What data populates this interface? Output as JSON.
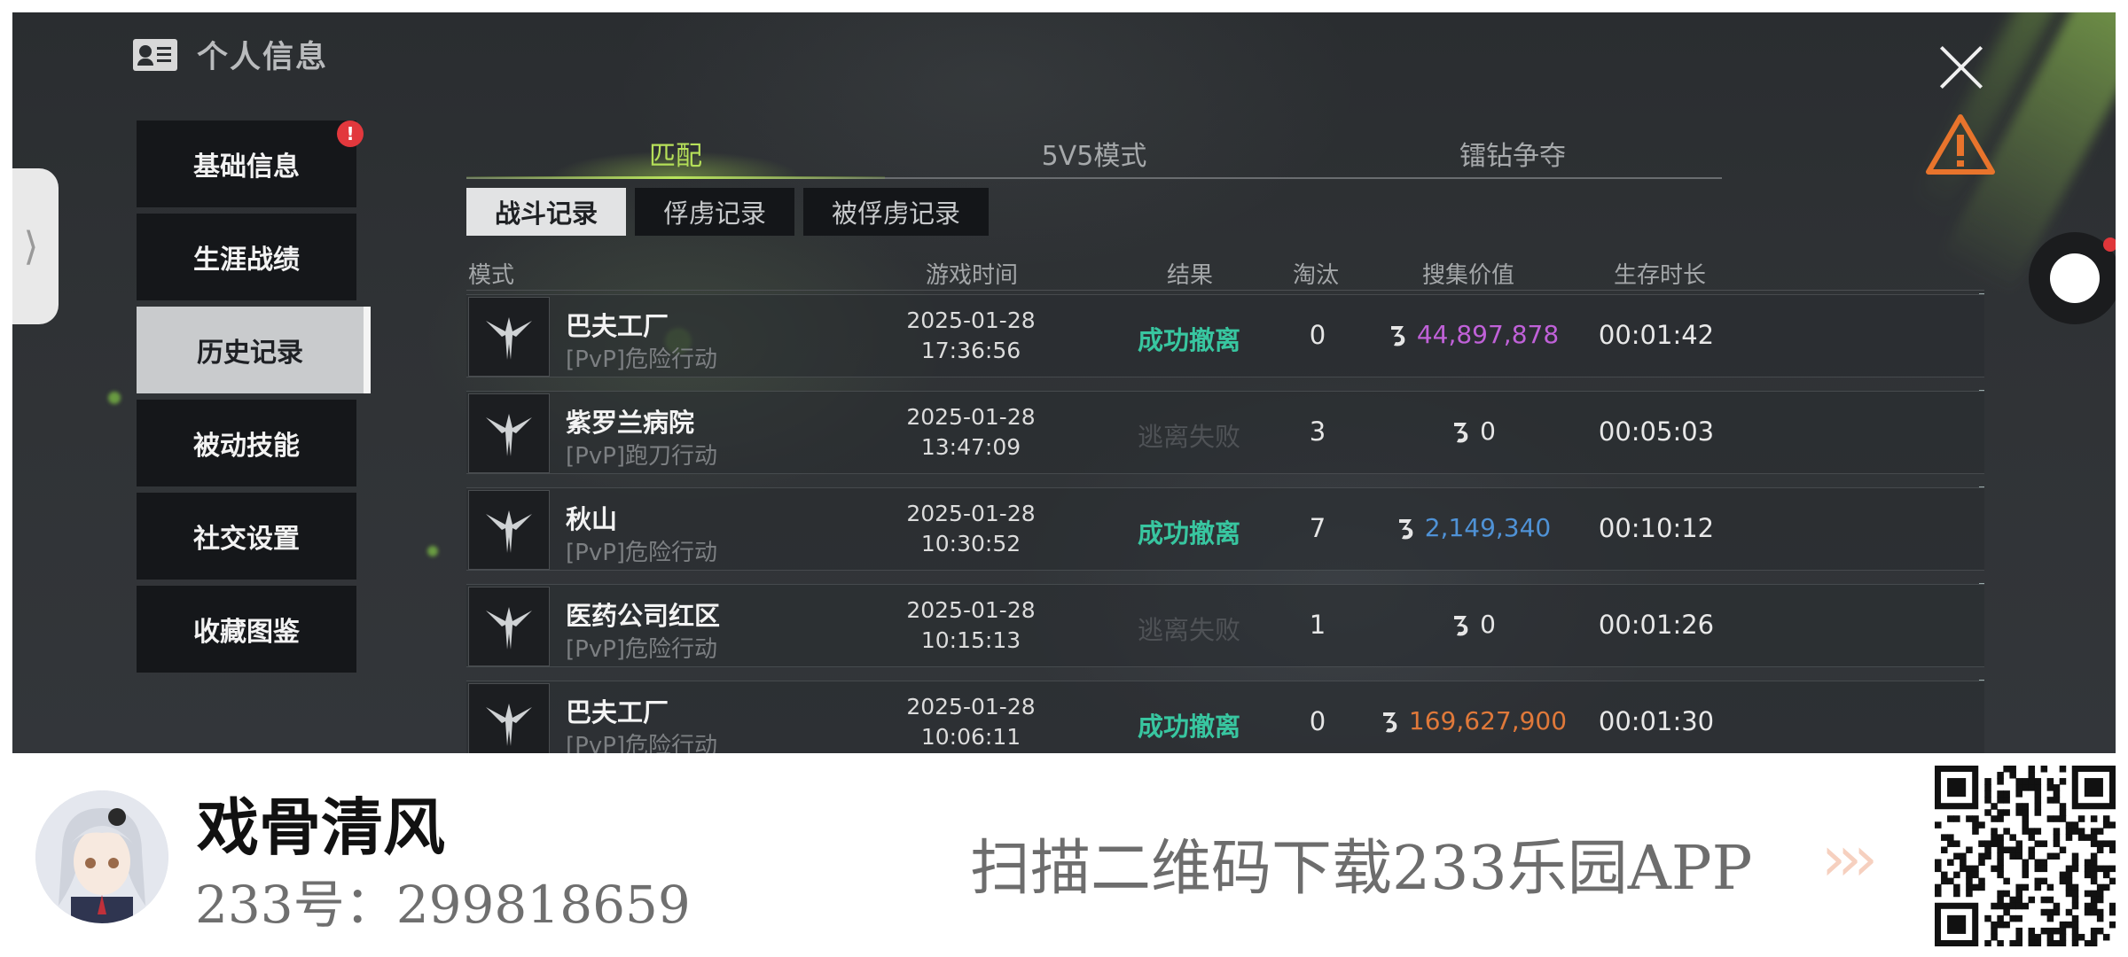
{
  "header": {
    "title": "个人信息"
  },
  "menu": {
    "items": [
      {
        "label": "基础信息",
        "badge": "!"
      },
      {
        "label": "生涯战绩"
      },
      {
        "label": "历史记录",
        "active": true
      },
      {
        "label": "被动技能"
      },
      {
        "label": "社交设置"
      },
      {
        "label": "收藏图鉴"
      }
    ]
  },
  "main_tabs": [
    {
      "label": "匹配",
      "active": true
    },
    {
      "label": "5V5模式"
    },
    {
      "label": "镭钻争夺"
    }
  ],
  "sub_tabs": [
    {
      "label": "战斗记录",
      "active": true
    },
    {
      "label": "俘虏记录"
    },
    {
      "label": "被俘虏记录"
    }
  ],
  "table": {
    "headers": {
      "mode": "模式",
      "game_time": "游戏时间",
      "result": "结果",
      "kills": "淘汰",
      "value": "搜集价值",
      "survival": "生存时长"
    },
    "rows": [
      {
        "map": "巴夫工厂",
        "mode": "[PvP]危险行动",
        "date": "2025-01-28",
        "time": "17:36:56",
        "result": "成功撤离",
        "kills": "0",
        "value": "44,897,878",
        "survival": "00:01:42"
      },
      {
        "map": "紫罗兰病院",
        "mode": "[PvP]跑刀行动",
        "date": "2025-01-28",
        "time": "13:47:09",
        "result": "逃离失败",
        "kills": "3",
        "value": "0",
        "survival": "00:05:03"
      },
      {
        "map": "秋山",
        "mode": "[PvP]危险行动",
        "date": "2025-01-28",
        "time": "10:30:52",
        "result": "成功撤离",
        "kills": "7",
        "value": "2,149,340",
        "survival": "00:10:12"
      },
      {
        "map": "医药公司红区",
        "mode": "[PvP]危险行动",
        "date": "2025-01-28",
        "time": "10:15:13",
        "result": "逃离失败",
        "kills": "1",
        "value": "0",
        "survival": "00:01:26"
      },
      {
        "map": "巴夫工厂",
        "mode": "[PvP]危险行动",
        "date": "2025-01-28",
        "time": "10:06:11",
        "result": "成功撤离",
        "kills": "0",
        "value": "169,627,900",
        "survival": "00:01:30"
      }
    ]
  },
  "colors": {
    "success": "#38c6a0",
    "fail": "#4f5256",
    "value_purple": "#c061d8",
    "value_blue": "#4f92d6",
    "value_orange": "#e0793a",
    "value_white": "#e6e6e6",
    "active_tab": "#b7e05a"
  },
  "banner": {
    "author_name": "戏骨清风",
    "author_id": "233号：299818659",
    "promo": "扫描二维码下载233乐园APP"
  }
}
